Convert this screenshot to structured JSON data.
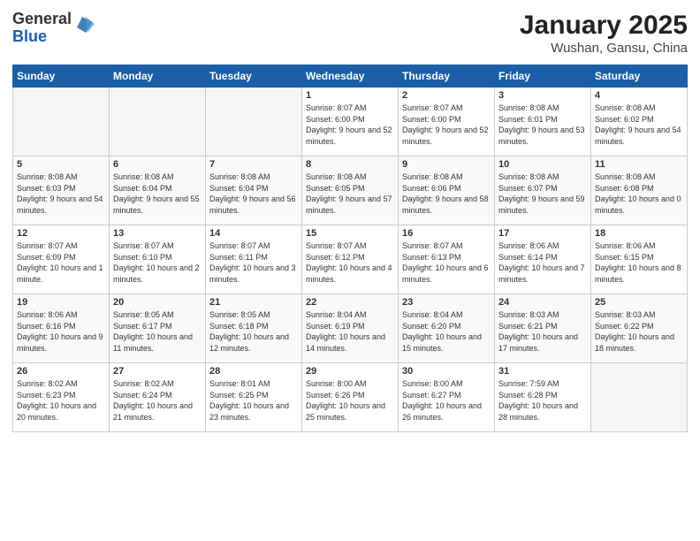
{
  "logo": {
    "general": "General",
    "blue": "Blue"
  },
  "title": "January 2025",
  "subtitle": "Wushan, Gansu, China",
  "weekdays": [
    "Sunday",
    "Monday",
    "Tuesday",
    "Wednesday",
    "Thursday",
    "Friday",
    "Saturday"
  ],
  "weeks": [
    [
      {
        "day": "",
        "info": ""
      },
      {
        "day": "",
        "info": ""
      },
      {
        "day": "",
        "info": ""
      },
      {
        "day": "1",
        "info": "Sunrise: 8:07 AM\nSunset: 6:00 PM\nDaylight: 9 hours and 52 minutes."
      },
      {
        "day": "2",
        "info": "Sunrise: 8:07 AM\nSunset: 6:00 PM\nDaylight: 9 hours and 52 minutes."
      },
      {
        "day": "3",
        "info": "Sunrise: 8:08 AM\nSunset: 6:01 PM\nDaylight: 9 hours and 53 minutes."
      },
      {
        "day": "4",
        "info": "Sunrise: 8:08 AM\nSunset: 6:02 PM\nDaylight: 9 hours and 54 minutes."
      }
    ],
    [
      {
        "day": "5",
        "info": "Sunrise: 8:08 AM\nSunset: 6:03 PM\nDaylight: 9 hours and 54 minutes."
      },
      {
        "day": "6",
        "info": "Sunrise: 8:08 AM\nSunset: 6:04 PM\nDaylight: 9 hours and 55 minutes."
      },
      {
        "day": "7",
        "info": "Sunrise: 8:08 AM\nSunset: 6:04 PM\nDaylight: 9 hours and 56 minutes."
      },
      {
        "day": "8",
        "info": "Sunrise: 8:08 AM\nSunset: 6:05 PM\nDaylight: 9 hours and 57 minutes."
      },
      {
        "day": "9",
        "info": "Sunrise: 8:08 AM\nSunset: 6:06 PM\nDaylight: 9 hours and 58 minutes."
      },
      {
        "day": "10",
        "info": "Sunrise: 8:08 AM\nSunset: 6:07 PM\nDaylight: 9 hours and 59 minutes."
      },
      {
        "day": "11",
        "info": "Sunrise: 8:08 AM\nSunset: 6:08 PM\nDaylight: 10 hours and 0 minutes."
      }
    ],
    [
      {
        "day": "12",
        "info": "Sunrise: 8:07 AM\nSunset: 6:09 PM\nDaylight: 10 hours and 1 minute."
      },
      {
        "day": "13",
        "info": "Sunrise: 8:07 AM\nSunset: 6:10 PM\nDaylight: 10 hours and 2 minutes."
      },
      {
        "day": "14",
        "info": "Sunrise: 8:07 AM\nSunset: 6:11 PM\nDaylight: 10 hours and 3 minutes."
      },
      {
        "day": "15",
        "info": "Sunrise: 8:07 AM\nSunset: 6:12 PM\nDaylight: 10 hours and 4 minutes."
      },
      {
        "day": "16",
        "info": "Sunrise: 8:07 AM\nSunset: 6:13 PM\nDaylight: 10 hours and 6 minutes."
      },
      {
        "day": "17",
        "info": "Sunrise: 8:06 AM\nSunset: 6:14 PM\nDaylight: 10 hours and 7 minutes."
      },
      {
        "day": "18",
        "info": "Sunrise: 8:06 AM\nSunset: 6:15 PM\nDaylight: 10 hours and 8 minutes."
      }
    ],
    [
      {
        "day": "19",
        "info": "Sunrise: 8:06 AM\nSunset: 6:16 PM\nDaylight: 10 hours and 9 minutes."
      },
      {
        "day": "20",
        "info": "Sunrise: 8:05 AM\nSunset: 6:17 PM\nDaylight: 10 hours and 11 minutes."
      },
      {
        "day": "21",
        "info": "Sunrise: 8:05 AM\nSunset: 6:18 PM\nDaylight: 10 hours and 12 minutes."
      },
      {
        "day": "22",
        "info": "Sunrise: 8:04 AM\nSunset: 6:19 PM\nDaylight: 10 hours and 14 minutes."
      },
      {
        "day": "23",
        "info": "Sunrise: 8:04 AM\nSunset: 6:20 PM\nDaylight: 10 hours and 15 minutes."
      },
      {
        "day": "24",
        "info": "Sunrise: 8:03 AM\nSunset: 6:21 PM\nDaylight: 10 hours and 17 minutes."
      },
      {
        "day": "25",
        "info": "Sunrise: 8:03 AM\nSunset: 6:22 PM\nDaylight: 10 hours and 18 minutes."
      }
    ],
    [
      {
        "day": "26",
        "info": "Sunrise: 8:02 AM\nSunset: 6:23 PM\nDaylight: 10 hours and 20 minutes."
      },
      {
        "day": "27",
        "info": "Sunrise: 8:02 AM\nSunset: 6:24 PM\nDaylight: 10 hours and 21 minutes."
      },
      {
        "day": "28",
        "info": "Sunrise: 8:01 AM\nSunset: 6:25 PM\nDaylight: 10 hours and 23 minutes."
      },
      {
        "day": "29",
        "info": "Sunrise: 8:00 AM\nSunset: 6:26 PM\nDaylight: 10 hours and 25 minutes."
      },
      {
        "day": "30",
        "info": "Sunrise: 8:00 AM\nSunset: 6:27 PM\nDaylight: 10 hours and 26 minutes."
      },
      {
        "day": "31",
        "info": "Sunrise: 7:59 AM\nSunset: 6:28 PM\nDaylight: 10 hours and 28 minutes."
      },
      {
        "day": "",
        "info": ""
      }
    ]
  ]
}
